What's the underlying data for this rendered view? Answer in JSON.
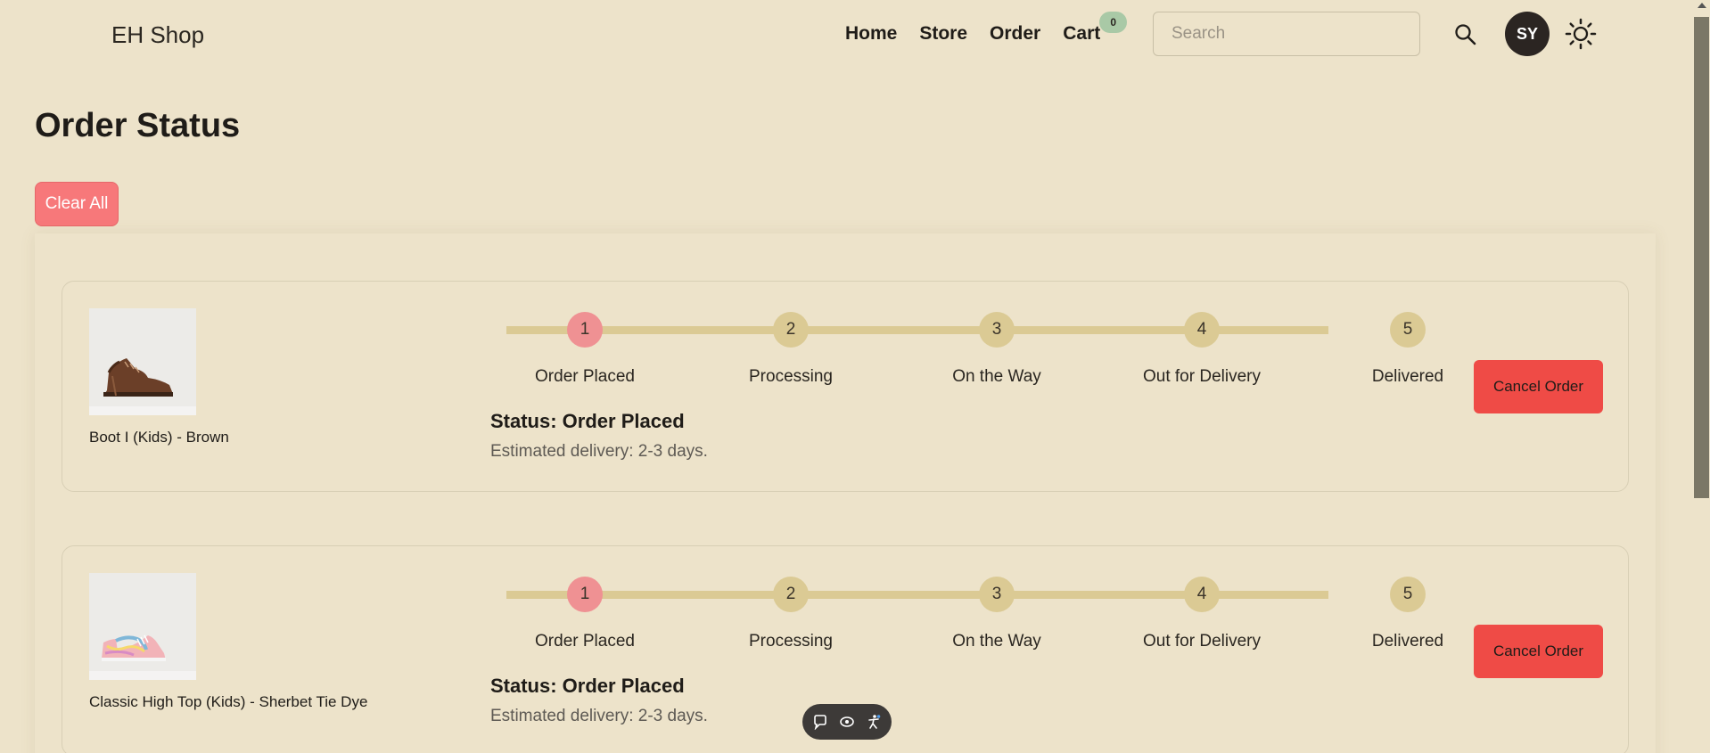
{
  "header": {
    "brand": "EH Shop",
    "nav": [
      "Home",
      "Store",
      "Order",
      "Cart"
    ],
    "cart_count": "0",
    "search_placeholder": "Search",
    "avatar_initials": "SY"
  },
  "page": {
    "title": "Order Status",
    "clear_all_label": "Clear All"
  },
  "steps": [
    "Order Placed",
    "Processing",
    "On the Way",
    "Out for Delivery",
    "Delivered"
  ],
  "step_numbers": [
    "1",
    "2",
    "3",
    "4",
    "5"
  ],
  "orders": [
    {
      "product_name": "Boot I (Kids) - Brown",
      "status": "Status: Order Placed",
      "eta": "Estimated delivery: 2-3 days.",
      "cancel_label": "Cancel Order",
      "current_step": 1
    },
    {
      "product_name": "Classic High Top (Kids) - Sherbet Tie Dye",
      "status": "Status: Order Placed",
      "eta": "Estimated delivery: 2-3 days.",
      "cancel_label": "Cancel Order",
      "current_step": 1
    }
  ],
  "colors": {
    "background": "#ede3ca",
    "step_active": "#ef9193",
    "step_inactive": "#dbca94",
    "cancel_button": "#ef4b46",
    "clear_button": "#f7787a",
    "cart_badge": "#a9c9a6"
  }
}
